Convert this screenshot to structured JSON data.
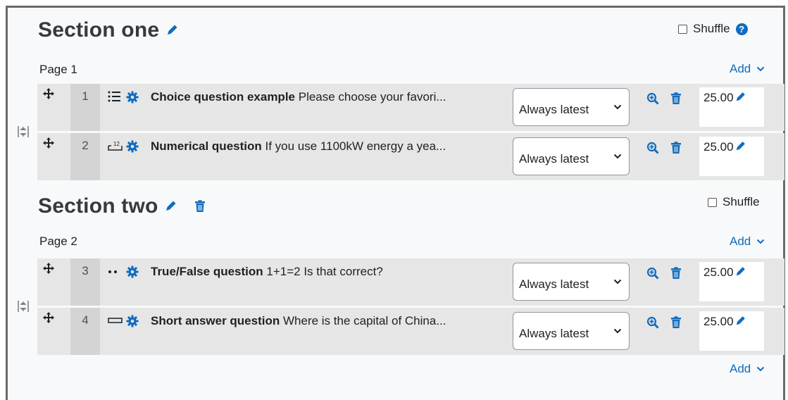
{
  "sections": [
    {
      "title": "Section one",
      "shuffle_label": "Shuffle",
      "page_label": "Page 1",
      "add_label": "Add",
      "slots": [
        {
          "number": "1",
          "type_icon": "multichoice-icon",
          "name": "Choice question example",
          "text": "Please choose your favori...",
          "version": "Always latest",
          "mark": "25.00"
        },
        {
          "number": "2",
          "type_icon": "numerical-icon",
          "name": "Numerical question",
          "text": "If you use 1100kW energy a yea...",
          "version": "Always latest",
          "mark": "25.00"
        }
      ]
    },
    {
      "title": "Section two",
      "shuffle_label": "Shuffle",
      "page_label": "Page 2",
      "add_label": "Add",
      "slots": [
        {
          "number": "3",
          "type_icon": "truefalse-icon",
          "name": "True/False question",
          "text": "1+1=2 Is that correct?",
          "version": "Always latest",
          "mark": "25.00"
        },
        {
          "number": "4",
          "type_icon": "shortanswer-icon",
          "name": "Short answer question",
          "text": "Where is the capital of China...",
          "version": "Always latest",
          "mark": "25.00"
        }
      ]
    }
  ],
  "bottom_add_label": "Add",
  "colors": {
    "accent": "#0f6cbf",
    "row_bg": "#e6e6e6",
    "slot_bg": "#d4d4d4"
  }
}
